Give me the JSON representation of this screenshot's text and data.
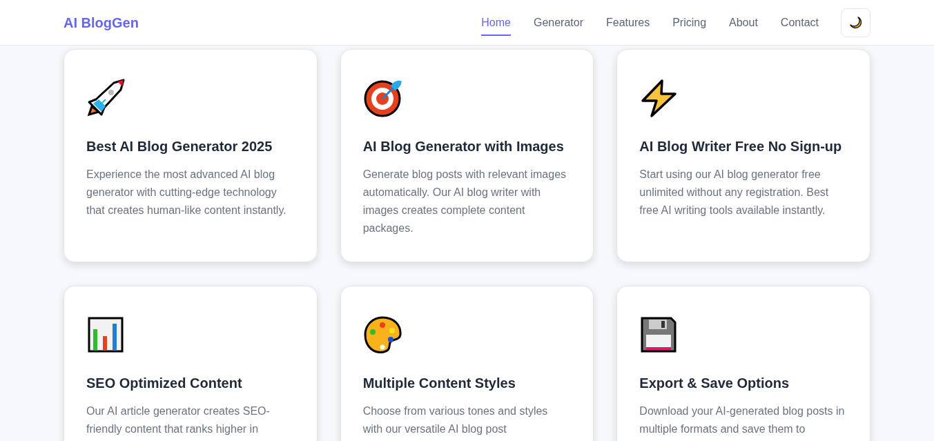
{
  "header": {
    "logo": "AI BlogGen",
    "nav": [
      {
        "label": "Home",
        "selected": true
      },
      {
        "label": "Generator",
        "selected": false
      },
      {
        "label": "Features",
        "selected": false
      },
      {
        "label": "Pricing",
        "selected": false
      },
      {
        "label": "About",
        "selected": false
      },
      {
        "label": "Contact",
        "selected": false
      }
    ]
  },
  "features": [
    {
      "title": "Best AI Blog Generator 2025",
      "description": "Experience the most advanced AI blog generator with cutting-edge technology that creates human-like content instantly."
    },
    {
      "title": "AI Blog Generator with Images",
      "description": "Generate blog posts with relevant images automatically. Our AI blog writer with images creates complete content packages."
    },
    {
      "title": "AI Blog Writer Free No Sign-up",
      "description": "Start using our AI blog generator free unlimited without any registration. Best free AI writing tools available instantly."
    },
    {
      "title": "SEO Optimized Content",
      "description": "Our AI article generator creates SEO-friendly content that ranks higher in"
    },
    {
      "title": "Multiple Content Styles",
      "description": "Choose from various tones and styles with our versatile AI blog post"
    },
    {
      "title": "Export & Save Options",
      "description": "Download your AI-generated blog posts in multiple formats and save them to"
    }
  ]
}
